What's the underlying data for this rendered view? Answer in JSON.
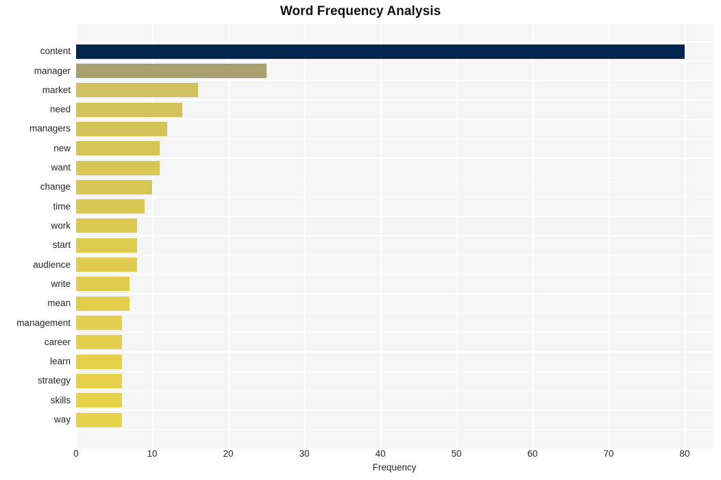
{
  "chart_data": {
    "type": "bar",
    "orientation": "horizontal",
    "title": "Word Frequency Analysis",
    "xlabel": "Frequency",
    "ylabel": "",
    "categories": [
      "content",
      "manager",
      "market",
      "need",
      "managers",
      "new",
      "want",
      "change",
      "time",
      "work",
      "start",
      "audience",
      "write",
      "mean",
      "management",
      "career",
      "learn",
      "strategy",
      "skills",
      "way"
    ],
    "values": [
      80,
      25,
      16,
      14,
      12,
      11,
      11,
      10,
      9,
      8,
      8,
      8,
      7,
      7,
      6,
      6,
      6,
      6,
      6,
      6
    ],
    "xlim": [
      0,
      84
    ],
    "xticks": [
      0,
      10,
      20,
      30,
      40,
      50,
      60,
      70,
      80
    ],
    "xtick_labels": [
      "0",
      "10",
      "20",
      "30",
      "40",
      "50",
      "60",
      "70",
      "80"
    ],
    "grid": true,
    "grid_color": "#ffffff",
    "legend": "none",
    "plot_background": "#f5f5f5",
    "figure_background": "#ffffff",
    "bar_colors": [
      "#04254e",
      "#a9a072",
      "#cec05e",
      "#d1c25b",
      "#d3c359",
      "#d5c456",
      "#d7c655",
      "#d9c753",
      "#dac852",
      "#dcc951",
      "#ddca50",
      "#dfcb4f",
      "#e0cc4e",
      "#e2cd4d",
      "#e3ce4d",
      "#e4cf4c",
      "#e5d04c",
      "#e6d04b",
      "#e7d14b",
      "#e8d14b"
    ]
  }
}
